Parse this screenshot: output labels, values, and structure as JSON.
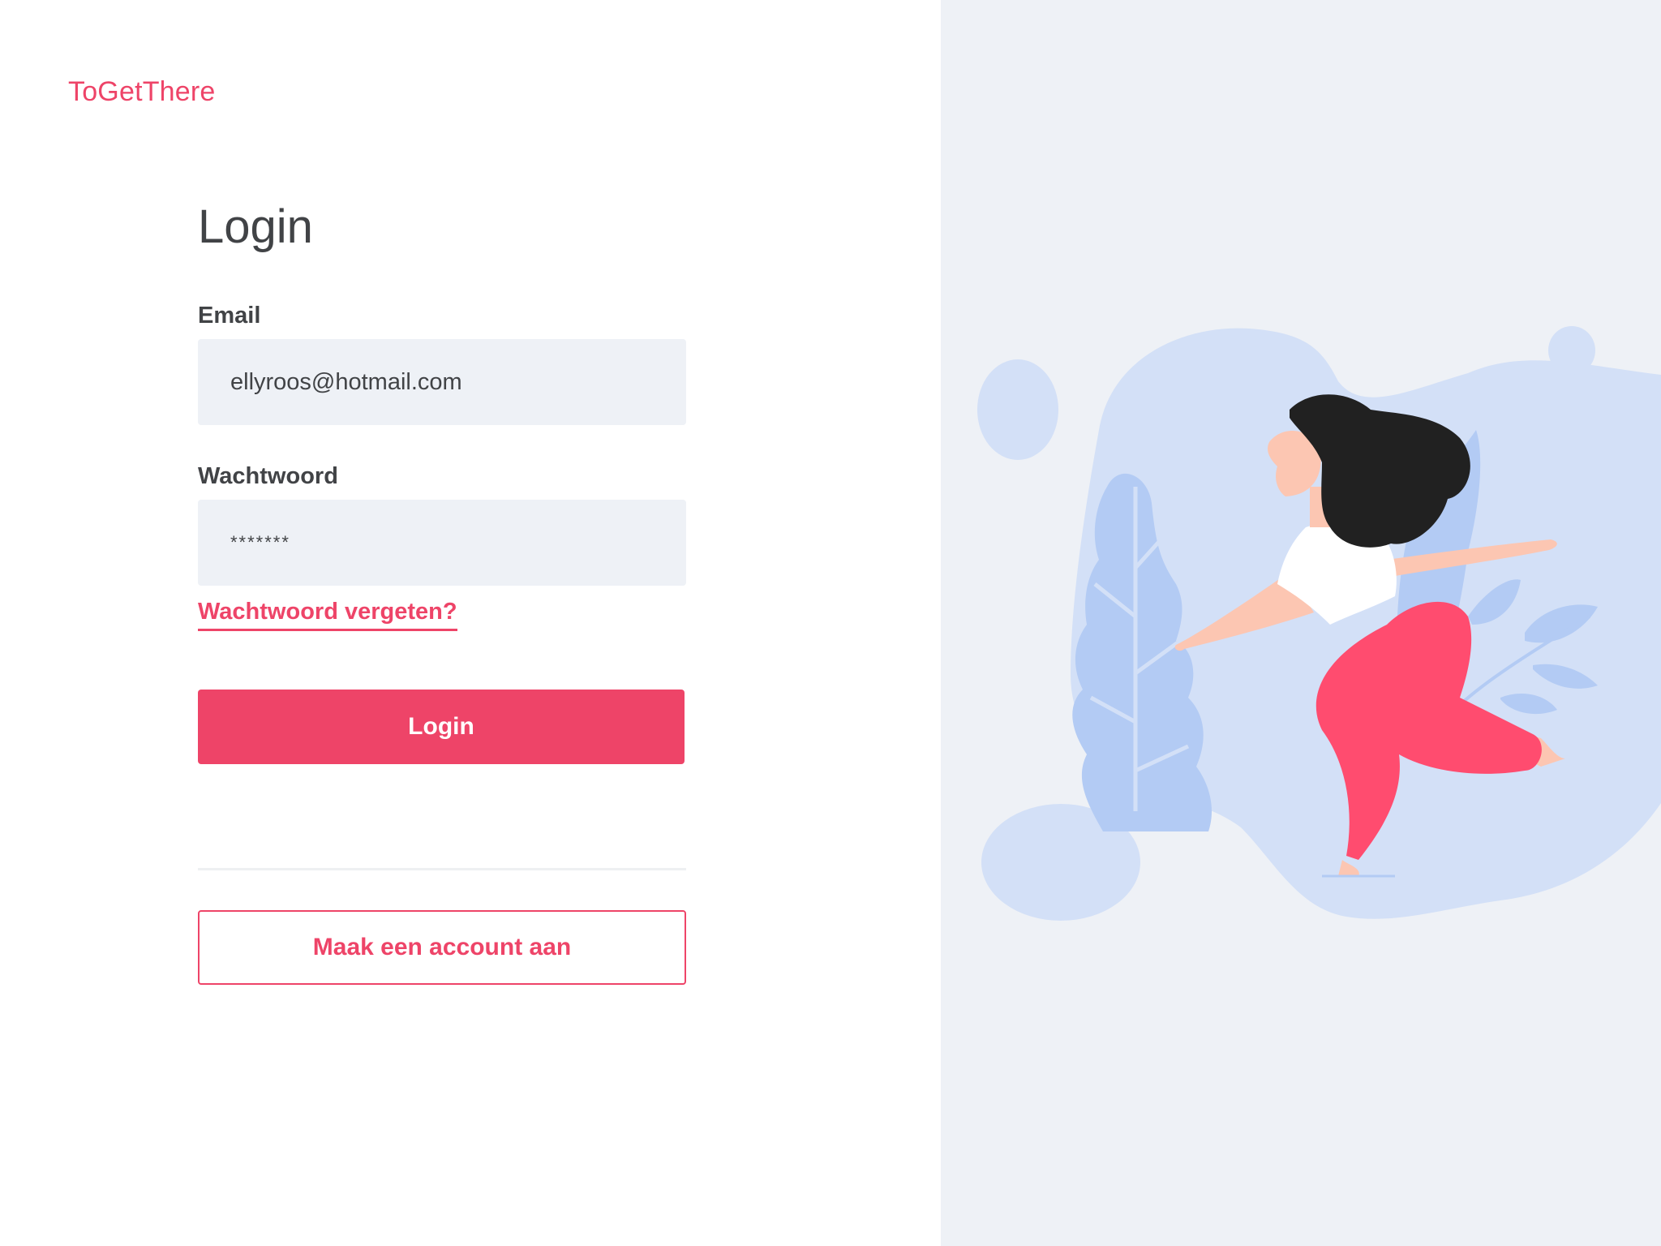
{
  "brand": {
    "name": "ToGetThere"
  },
  "login_form": {
    "title": "Login",
    "email_label": "Email",
    "email_value": "ellyroos@hotmail.com",
    "password_label": "Wachtwoord",
    "password_value": "*******",
    "forgot_password_link": "Wachtwoord vergeten?",
    "login_button": "Login",
    "create_account_button": "Maak een account aan"
  },
  "colors": {
    "accent": "#ee4468",
    "text": "#414346",
    "field_background": "#eef1f6",
    "illustration_background": "#eef1f6",
    "illustration_blob": "#d3e0f7",
    "illustration_leaves": "#b3cbf4"
  },
  "illustration": {
    "icon": "woman-running-illustration"
  }
}
